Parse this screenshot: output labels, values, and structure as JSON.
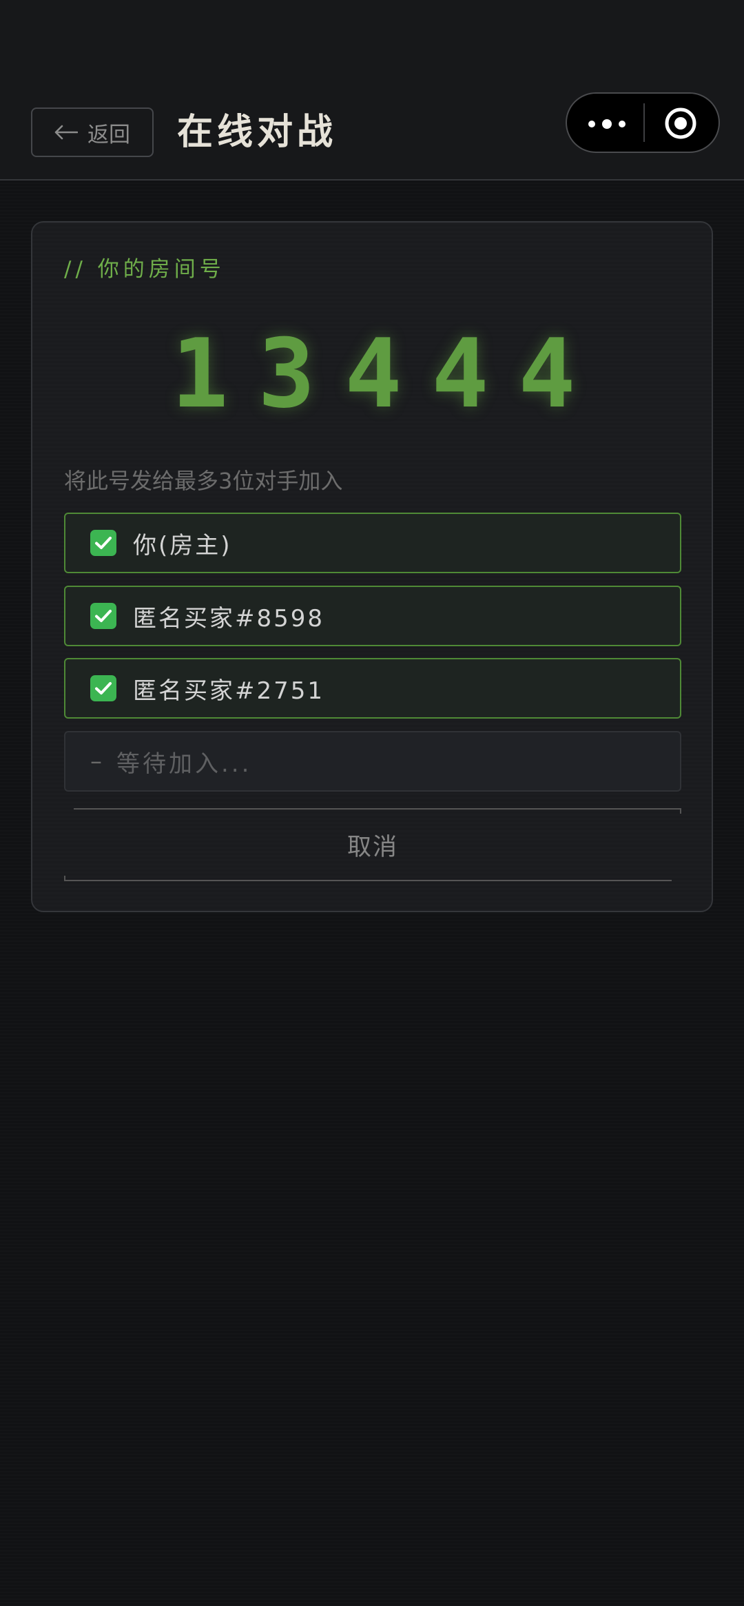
{
  "header": {
    "back_label": "返回",
    "title": "在线对战"
  },
  "capsule": {
    "icons": [
      "more-icon",
      "target-icon"
    ]
  },
  "room": {
    "label": "//  你的房间号",
    "digits": [
      "1",
      "3",
      "4",
      "4",
      "4"
    ],
    "hint": "将此号发给最多3位对手加入"
  },
  "players": [
    {
      "name": "你(房主)",
      "status": "joined"
    },
    {
      "name": "匿名买家#8598",
      "status": "joined"
    },
    {
      "name": "匿名买家#2751",
      "status": "joined"
    }
  ],
  "waiting": {
    "dash": "–",
    "label": "等待加入..."
  },
  "cancel_label": "取消",
  "colors": {
    "accent": "#5f9c41",
    "check": "#3cb552",
    "background": "#111214"
  }
}
